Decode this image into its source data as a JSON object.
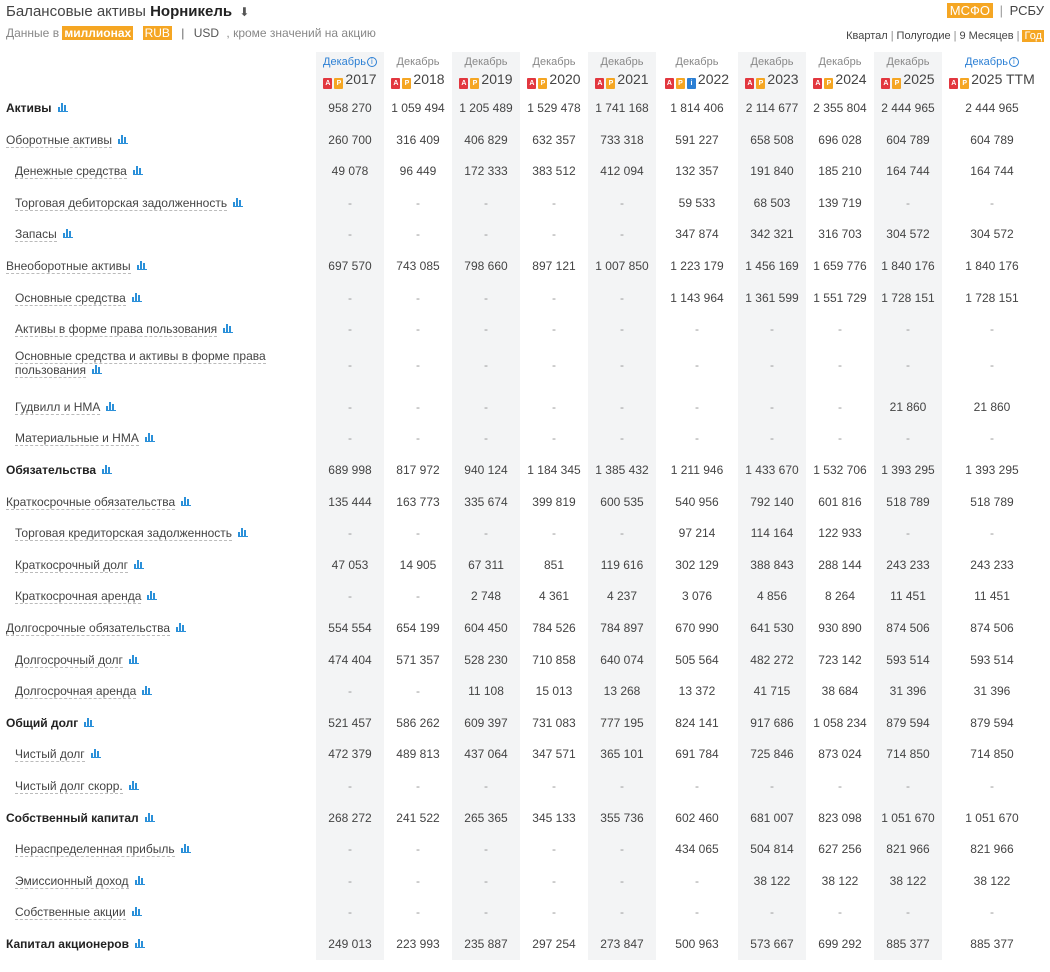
{
  "header": {
    "title_prefix": "Балансовые активы",
    "company": "Норникель",
    "download_icon": "⬇",
    "sub_prefix": "Данные в",
    "sub_unit": "миллионах",
    "cur_rub": "RUB",
    "cur_sep": "|",
    "cur_usd": "USD",
    "sub_note": ", кроме значений на акцию",
    "std_msfo": "МСФО",
    "std_sep": "|",
    "std_rsbu": "РСБУ",
    "periods": [
      "Квартал",
      "Полугодие",
      "9 Месяцев",
      "Год"
    ],
    "active_period": "Год"
  },
  "accent_color": "#f5a623",
  "columns": [
    {
      "month": "Декабрь",
      "year": "2017",
      "docs": [
        "pdf",
        "p"
      ],
      "info": true
    },
    {
      "month": "Декабрь",
      "year": "2018",
      "docs": [
        "pdf",
        "p"
      ],
      "info": false
    },
    {
      "month": "Декабрь",
      "year": "2019",
      "docs": [
        "pdf",
        "p"
      ],
      "info": false
    },
    {
      "month": "Декабрь",
      "year": "2020",
      "docs": [
        "pdf",
        "p"
      ],
      "info": false
    },
    {
      "month": "Декабрь",
      "year": "2021",
      "docs": [
        "pdf",
        "p"
      ],
      "info": false
    },
    {
      "month": "Декабрь",
      "year": "2022",
      "docs": [
        "pdf",
        "p",
        "blue"
      ],
      "info": false
    },
    {
      "month": "Декабрь",
      "year": "2023",
      "docs": [
        "pdf",
        "p"
      ],
      "info": false
    },
    {
      "month": "Декабрь",
      "year": "2024",
      "docs": [
        "pdf",
        "p"
      ],
      "info": false
    },
    {
      "month": "Декабрь",
      "year": "2025",
      "docs": [
        "pdf",
        "p"
      ],
      "info": false
    },
    {
      "month": "Декабрь",
      "year": "2025 TTM",
      "docs": [
        "pdf",
        "p"
      ],
      "info": true
    }
  ],
  "rows": [
    {
      "label": "Активы",
      "bold": true,
      "values": [
        "958 270",
        "1 059 494",
        "1 205 489",
        "1 529 478",
        "1 741 168",
        "1 814 406",
        "2 114 677",
        "2 355 804",
        "2 444 965",
        "2 444 965"
      ]
    },
    {
      "label": "Оборотные активы",
      "values": [
        "260 700",
        "316 409",
        "406 829",
        "632 357",
        "733 318",
        "591 227",
        "658 508",
        "696 028",
        "604 789",
        "604 789"
      ]
    },
    {
      "label": "Денежные средства",
      "l2": true,
      "values": [
        "49 078",
        "96 449",
        "172 333",
        "383 512",
        "412 094",
        "132 357",
        "191 840",
        "185 210",
        "164 744",
        "164 744"
      ]
    },
    {
      "label": "Торговая дебиторская задолженность",
      "l2": true,
      "values": [
        "-",
        "-",
        "-",
        "-",
        "-",
        "59 533",
        "68 503",
        "139 719",
        "-",
        "-"
      ]
    },
    {
      "label": "Запасы",
      "l2": true,
      "values": [
        "-",
        "-",
        "-",
        "-",
        "-",
        "347 874",
        "342 321",
        "316 703",
        "304 572",
        "304 572"
      ]
    },
    {
      "label": "Внеоборотные активы",
      "values": [
        "697 570",
        "743 085",
        "798 660",
        "897 121",
        "1 007 850",
        "1 223 179",
        "1 456 169",
        "1 659 776",
        "1 840 176",
        "1 840 176"
      ]
    },
    {
      "label": "Основные средства",
      "l2": true,
      "values": [
        "-",
        "-",
        "-",
        "-",
        "-",
        "1 143 964",
        "1 361 599",
        "1 551 729",
        "1 728 151",
        "1 728 151"
      ]
    },
    {
      "label": "Активы в форме права пользования",
      "l2": true,
      "values": [
        "-",
        "-",
        "-",
        "-",
        "-",
        "-",
        "-",
        "-",
        "-",
        "-"
      ]
    },
    {
      "label": "Основные средства и активы в форме права пользования",
      "l2": true,
      "tall": true,
      "values": [
        "-",
        "-",
        "-",
        "-",
        "-",
        "-",
        "-",
        "-",
        "-",
        "-"
      ]
    },
    {
      "label": "Гудвилл и НМА",
      "l2": true,
      "values": [
        "-",
        "-",
        "-",
        "-",
        "-",
        "-",
        "-",
        "-",
        "21 860",
        "21 860"
      ]
    },
    {
      "label": "Материальные и НМА",
      "l2": true,
      "values": [
        "-",
        "-",
        "-",
        "-",
        "-",
        "-",
        "-",
        "-",
        "-",
        "-"
      ]
    },
    {
      "label": "Обязательства",
      "bold": true,
      "values": [
        "689 998",
        "817 972",
        "940 124",
        "1 184 345",
        "1 385 432",
        "1 211 946",
        "1 433 670",
        "1 532 706",
        "1 393 295",
        "1 393 295"
      ]
    },
    {
      "label": "Краткосрочные обязательства",
      "values": [
        "135 444",
        "163 773",
        "335 674",
        "399 819",
        "600 535",
        "540 956",
        "792 140",
        "601 816",
        "518 789",
        "518 789"
      ]
    },
    {
      "label": "Торговая кредиторская задолженность",
      "l2": true,
      "values": [
        "-",
        "-",
        "-",
        "-",
        "-",
        "97 214",
        "114 164",
        "122 933",
        "-",
        "-"
      ]
    },
    {
      "label": "Краткосрочный долг",
      "l2": true,
      "values": [
        "47 053",
        "14 905",
        "67 311",
        "851",
        "119 616",
        "302 129",
        "388 843",
        "288 144",
        "243 233",
        "243 233"
      ]
    },
    {
      "label": "Краткосрочная аренда",
      "l2": true,
      "values": [
        "-",
        "-",
        "2 748",
        "4 361",
        "4 237",
        "3 076",
        "4 856",
        "8 264",
        "11 451",
        "11 451"
      ]
    },
    {
      "label": "Долгосрочные обязательства",
      "values": [
        "554 554",
        "654 199",
        "604 450",
        "784 526",
        "784 897",
        "670 990",
        "641 530",
        "930 890",
        "874 506",
        "874 506"
      ]
    },
    {
      "label": "Долгосрочный долг",
      "l2": true,
      "values": [
        "474 404",
        "571 357",
        "528 230",
        "710 858",
        "640 074",
        "505 564",
        "482 272",
        "723 142",
        "593 514",
        "593 514"
      ]
    },
    {
      "label": "Долгосрочная аренда",
      "l2": true,
      "values": [
        "-",
        "-",
        "11 108",
        "15 013",
        "13 268",
        "13 372",
        "41 715",
        "38 684",
        "31 396",
        "31 396"
      ]
    },
    {
      "label": "Общий долг",
      "bold": true,
      "values": [
        "521 457",
        "586 262",
        "609 397",
        "731 083",
        "777 195",
        "824 141",
        "917 686",
        "1 058 234",
        "879 594",
        "879 594"
      ]
    },
    {
      "label": "Чистый долг",
      "l2": true,
      "values": [
        "472 379",
        "489 813",
        "437 064",
        "347 571",
        "365 101",
        "691 784",
        "725 846",
        "873 024",
        "714 850",
        "714 850"
      ]
    },
    {
      "label": "Чистый долг скорр.",
      "l2": true,
      "values": [
        "-",
        "-",
        "-",
        "-",
        "-",
        "-",
        "-",
        "-",
        "-",
        "-"
      ]
    },
    {
      "label": "Собственный капитал",
      "bold": true,
      "values": [
        "268 272",
        "241 522",
        "265 365",
        "345 133",
        "355 736",
        "602 460",
        "681 007",
        "823 098",
        "1 051 670",
        "1 051 670"
      ]
    },
    {
      "label": "Нераспределенная прибыль",
      "l2": true,
      "values": [
        "-",
        "-",
        "-",
        "-",
        "-",
        "434 065",
        "504 814",
        "627 256",
        "821 966",
        "821 966"
      ]
    },
    {
      "label": "Эмиссионный доход",
      "l2": true,
      "values": [
        "-",
        "-",
        "-",
        "-",
        "-",
        "-",
        "38 122",
        "38 122",
        "38 122",
        "38 122"
      ]
    },
    {
      "label": "Собственные акции",
      "l2": true,
      "values": [
        "-",
        "-",
        "-",
        "-",
        "-",
        "-",
        "-",
        "-",
        "-",
        "-"
      ]
    },
    {
      "label": "Капитал акционеров",
      "bold": true,
      "values": [
        "249 013",
        "223 993",
        "235 887",
        "297 254",
        "273 847",
        "500 963",
        "573 667",
        "699 292",
        "885 377",
        "885 377"
      ]
    }
  ]
}
